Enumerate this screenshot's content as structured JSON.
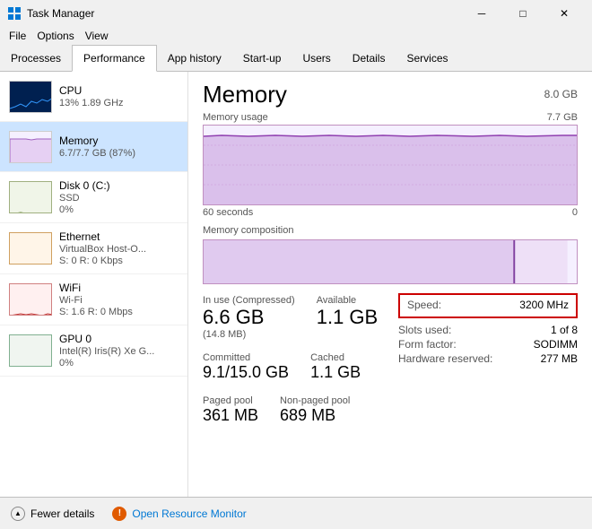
{
  "titleBar": {
    "title": "Task Manager",
    "minBtn": "─",
    "maxBtn": "□",
    "closeBtn": "✕"
  },
  "menuBar": {
    "items": [
      "File",
      "Options",
      "View"
    ]
  },
  "tabs": [
    {
      "id": "processes",
      "label": "Processes"
    },
    {
      "id": "performance",
      "label": "Performance"
    },
    {
      "id": "app-history",
      "label": "App history"
    },
    {
      "id": "startup",
      "label": "Start-up"
    },
    {
      "id": "users",
      "label": "Users"
    },
    {
      "id": "details",
      "label": "Details"
    },
    {
      "id": "services",
      "label": "Services"
    }
  ],
  "sidebar": {
    "items": [
      {
        "id": "cpu",
        "label": "CPU",
        "sub1": "13%  1.89 GHz",
        "sub2": "",
        "chartType": "cpu"
      },
      {
        "id": "memory",
        "label": "Memory",
        "sub1": "6.7/7.7 GB (87%)",
        "sub2": "",
        "chartType": "memory",
        "active": true
      },
      {
        "id": "disk0",
        "label": "Disk 0 (C:)",
        "sub1": "SSD",
        "sub2": "0%",
        "chartType": "disk"
      },
      {
        "id": "ethernet",
        "label": "Ethernet",
        "sub1": "VirtualBox Host-O...",
        "sub2": "S: 0 R: 0 Kbps",
        "chartType": "ethernet"
      },
      {
        "id": "wifi",
        "label": "WiFi",
        "sub1": "Wi-Fi",
        "sub2": "S: 1.6 R: 0 Mbps",
        "chartType": "wifi"
      },
      {
        "id": "gpu0",
        "label": "GPU 0",
        "sub1": "Intel(R) Iris(R) Xe G...",
        "sub2": "0%",
        "chartType": "gpu"
      }
    ]
  },
  "panel": {
    "title": "Memory",
    "totalLabel": "8.0 GB",
    "usageChartLabel": "Memory usage",
    "usageChartRight": "7.7 GB",
    "timeLeft": "60 seconds",
    "timeRight": "0",
    "compositionLabel": "Memory composition",
    "stats": {
      "inUseLabel": "In use (Compressed)",
      "inUseValue": "6.6 GB",
      "inUseSub": "(14.8 MB)",
      "availableLabel": "Available",
      "availableValue": "1.1 GB",
      "committedLabel": "Committed",
      "committedValue": "9.1/15.0 GB",
      "cachedLabel": "Cached",
      "cachedValue": "1.1 GB",
      "pagedPoolLabel": "Paged pool",
      "pagedPoolValue": "361 MB",
      "nonPagedPoolLabel": "Non-paged pool",
      "nonPagedPoolValue": "689 MB"
    },
    "infoPanel": {
      "speedLabel": "Speed:",
      "speedValue": "3200 MHz",
      "slotsLabel": "Slots used:",
      "slotsValue": "1 of 8",
      "formLabel": "Form factor:",
      "formValue": "SODIMM",
      "hwReservedLabel": "Hardware reserved:",
      "hwReservedValue": "277 MB"
    }
  },
  "footer": {
    "fewerDetailsLabel": "Fewer details",
    "openMonitorLabel": "Open Resource Monitor"
  }
}
